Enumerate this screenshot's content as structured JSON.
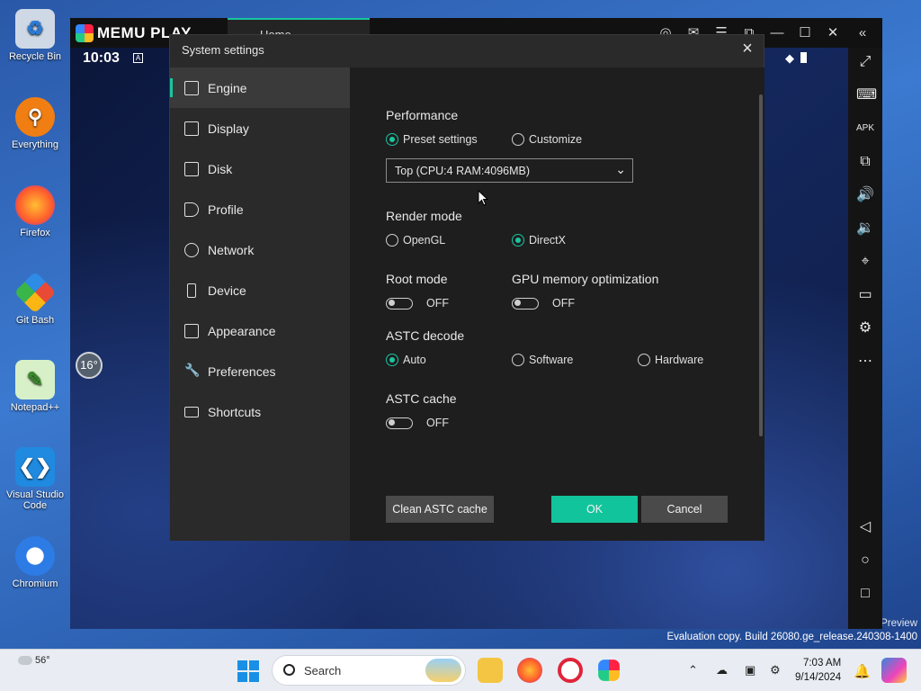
{
  "desktop": {
    "icons": [
      {
        "label": "Recycle Bin"
      },
      {
        "label": "Everything"
      },
      {
        "label": "Firefox"
      },
      {
        "label": "Git Bash"
      },
      {
        "label": "Notepad++"
      },
      {
        "label": "Visual Studio Code"
      },
      {
        "label": "Chromium"
      }
    ],
    "eval_line1": "Preview",
    "eval_line2": "Evaluation copy. Build 26080.ge_release.240308-1400"
  },
  "memu": {
    "logo": "MEMU PLAY",
    "tab_label": "Home",
    "android": {
      "time": "10:03",
      "status_a": "A",
      "temp_badge": "16°"
    }
  },
  "dialog": {
    "title": "System settings",
    "nav": [
      {
        "label": "Engine",
        "icon": "chip-icon",
        "active": true
      },
      {
        "label": "Display",
        "icon": "monitor-icon"
      },
      {
        "label": "Disk",
        "icon": "disk-icon"
      },
      {
        "label": "Profile",
        "icon": "tag-icon"
      },
      {
        "label": "Network",
        "icon": "globe-icon"
      },
      {
        "label": "Device",
        "icon": "phone-icon"
      },
      {
        "label": "Appearance",
        "icon": "window-icon"
      },
      {
        "label": "Preferences",
        "icon": "wrench-icon"
      },
      {
        "label": "Shortcuts",
        "icon": "keyboard-icon"
      }
    ],
    "performance": {
      "heading": "Performance",
      "preset_label": "Preset settings",
      "customize_label": "Customize",
      "selected": "Preset settings",
      "preset_value": "Top (CPU:4 RAM:4096MB)"
    },
    "render_mode": {
      "heading": "Render mode",
      "opengl_label": "OpenGL",
      "directx_label": "DirectX",
      "selected": "DirectX"
    },
    "root_mode": {
      "heading": "Root mode",
      "state": "OFF"
    },
    "gpu_mem": {
      "heading": "GPU memory optimization",
      "state": "OFF"
    },
    "astc_decode": {
      "heading": "ASTC decode",
      "auto_label": "Auto",
      "software_label": "Software",
      "hardware_label": "Hardware",
      "selected": "Auto"
    },
    "astc_cache": {
      "heading": "ASTC cache",
      "state": "OFF"
    },
    "buttons": {
      "clean": "Clean ASTC cache",
      "ok": "OK",
      "cancel": "Cancel"
    }
  },
  "taskbar": {
    "weather": "56°",
    "search_placeholder": "Search",
    "time": "7:03 AM",
    "date": "9/14/2024"
  },
  "colors": {
    "accent": "#19c6a0",
    "ok_button": "#12c49b",
    "dialog_bg": "#2a2a2a",
    "content_bg": "#1e1e1e"
  }
}
